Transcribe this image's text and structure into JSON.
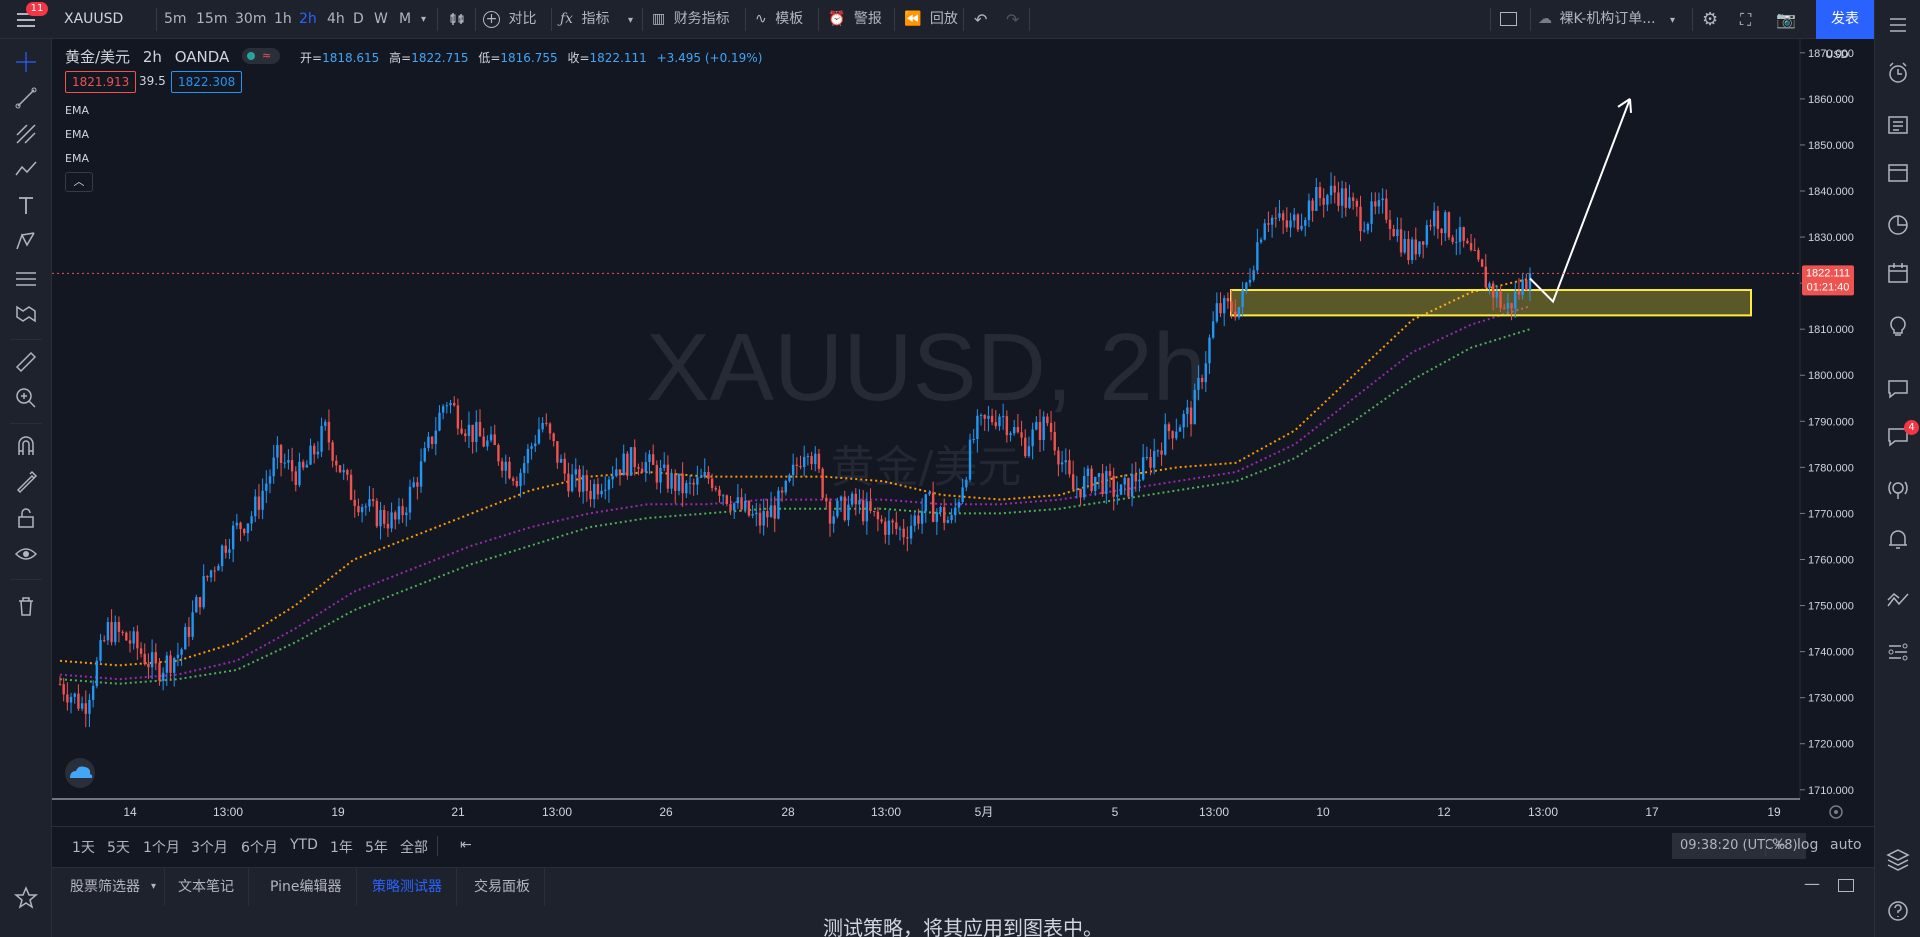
{
  "toolbar": {
    "symbol": "XAUUSD",
    "notification_count": "11",
    "intervals": [
      "5m",
      "15m",
      "30m",
      "1h",
      "2h",
      "4h",
      "D",
      "W",
      "M"
    ],
    "active_interval": "2h",
    "compare_label": "对比",
    "indicators_label": "指标",
    "financials_label": "财务指标",
    "templates_label": "模板",
    "alert_label": "警报",
    "replay_label": "回放",
    "layout_name": "裸K-机构订单...",
    "publish_label": "发表"
  },
  "legend": {
    "title": "黄金/美元",
    "interval": "2h",
    "source": "OANDA",
    "open_label": "开=",
    "open": "1818.615",
    "high_label": "高=",
    "high": "1822.715",
    "low_label": "低=",
    "low": "1816.755",
    "close_label": "收=",
    "close": "1822.111",
    "change": "+3.495 (+0.19%)",
    "bid": "1821.913",
    "spread": "39.5",
    "ask": "1822.308",
    "indicators": [
      "EMA",
      "EMA",
      "EMA"
    ]
  },
  "watermark": {
    "main": "XAUUSD, 2h",
    "sub": "黄金/美元"
  },
  "price_axis": {
    "currency": "USD",
    "last_price": "1822.111",
    "countdown": "01:21:40"
  },
  "chart_data": {
    "type": "candlestick",
    "symbol": "XAUUSD",
    "interval": "2h",
    "ylim": [
      1708,
      1873
    ],
    "y_ticks": [
      1710,
      1720,
      1730,
      1740,
      1750,
      1760,
      1770,
      1780,
      1790,
      1800,
      1810,
      1820,
      1830,
      1840,
      1850,
      1860,
      1870
    ],
    "y_tick_labels": [
      "1710.000",
      "1720.000",
      "1730.000",
      "1740.000",
      "1750.000",
      "1760.000",
      "1770.000",
      "1780.000",
      "1790.000",
      "1800.000",
      "1810.000",
      "1820.000",
      "1830.000",
      "1840.000",
      "1850.000",
      "1860.000",
      "1870.000"
    ],
    "x_tick_labels": [
      "14",
      "13:00",
      "19",
      "21",
      "13:00",
      "26",
      "28",
      "13:00",
      "5月",
      "5",
      "13:00",
      "10",
      "12",
      "13:00",
      "17",
      "19"
    ],
    "path": [
      1733,
      1728,
      1745,
      1742,
      1736,
      1740,
      1755,
      1765,
      1770,
      1782,
      1778,
      1788,
      1775,
      1770,
      1768,
      1780,
      1795,
      1788,
      1784,
      1778,
      1790,
      1778,
      1775,
      1780,
      1782,
      1778,
      1775,
      1778,
      1772,
      1768,
      1773,
      1786,
      1770,
      1772,
      1768,
      1766,
      1772,
      1768,
      1788,
      1792,
      1785,
      1790,
      1775,
      1778,
      1774,
      1780,
      1788,
      1792,
      1814,
      1815,
      1835,
      1832,
      1838,
      1840,
      1834,
      1836,
      1826,
      1835,
      1830,
      1822,
      1814,
      1822
    ],
    "ema_series": [
      {
        "color": "#ff9800",
        "values": [
          1738,
          1737,
          1738,
          1742,
          1750,
          1760,
          1765,
          1770,
          1775,
          1778,
          1779,
          1778,
          1778,
          1778,
          1777,
          1774,
          1773,
          1774,
          1778,
          1780,
          1781,
          1788,
          1800,
          1812,
          1818,
          1821
        ]
      },
      {
        "color": "#9c27b0",
        "values": [
          1735,
          1734,
          1735,
          1738,
          1745,
          1753,
          1758,
          1763,
          1767,
          1770,
          1772,
          1772,
          1773,
          1773,
          1773,
          1772,
          1772,
          1773,
          1775,
          1777,
          1779,
          1785,
          1795,
          1805,
          1811,
          1815
        ]
      },
      {
        "color": "#4caf50",
        "values": [
          1734,
          1733,
          1734,
          1736,
          1742,
          1749,
          1754,
          1759,
          1763,
          1767,
          1769,
          1770,
          1771,
          1771,
          1771,
          1770,
          1770,
          1771,
          1773,
          1775,
          1777,
          1782,
          1790,
          1799,
          1806,
          1810
        ]
      }
    ],
    "zone": {
      "low": 1813,
      "high": 1818.5
    },
    "projection_target": 1860
  },
  "range_bar": {
    "ranges": [
      "1天",
      "5天",
      "1个月",
      "3个月",
      "6个月",
      "YTD",
      "1年",
      "5年",
      "全部"
    ],
    "clock": "09:38:20 (UTC+8)",
    "percent": "%",
    "log": "log",
    "auto": "auto"
  },
  "bottom_panel": {
    "tabs": [
      "股票筛选器",
      "文本笔记",
      "Pine编辑器",
      "策略测试器",
      "交易面板"
    ],
    "active_tab": "策略测试器",
    "message": "测试策略，将其应用到图表中。"
  },
  "right_badge": "4",
  "colors": {
    "up": "#2196f3",
    "down": "#ef5350",
    "zone": "#ffeb3b",
    "accent": "#2962ff"
  }
}
